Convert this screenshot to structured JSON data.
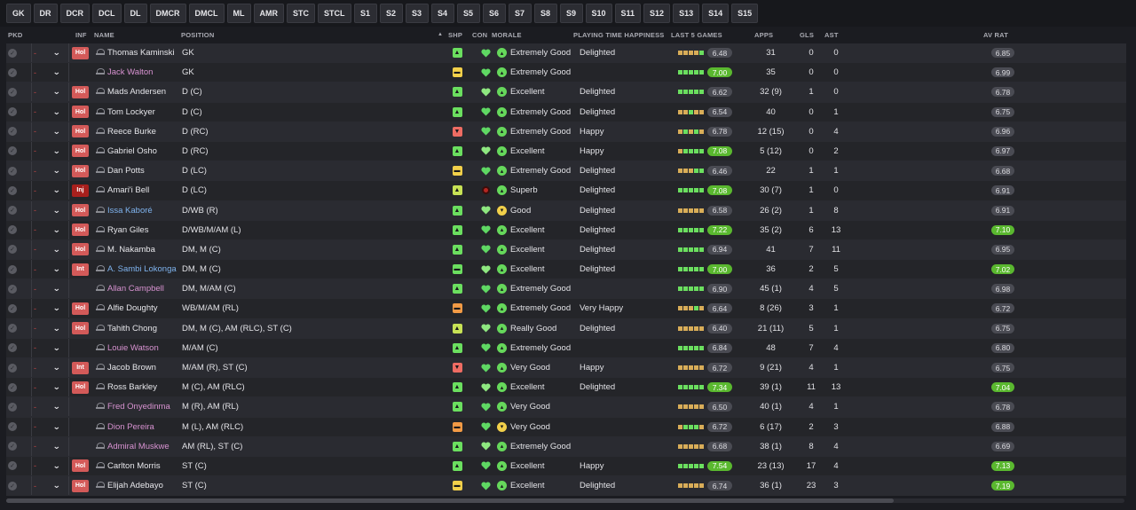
{
  "filters": [
    "GK",
    "DR",
    "DCR",
    "DCL",
    "DL",
    "DMCR",
    "DMCL",
    "ML",
    "AMR",
    "STC",
    "STCL",
    "S1",
    "S2",
    "S3",
    "S4",
    "S5",
    "S6",
    "S7",
    "S8",
    "S9",
    "S10",
    "S11",
    "S12",
    "S13",
    "S14",
    "S15"
  ],
  "headers": {
    "pkd": "PKD",
    "inf": "INF",
    "name": "NAME",
    "position": "POSITION",
    "sort": "▲",
    "shp": "SHP",
    "con": "CON",
    "morale": "MORALE",
    "pth": "PLAYING TIME HAPPINESS",
    "last5": "LAST 5 GAMES",
    "apps": "APPS",
    "gls": "GLS",
    "ast": "AST",
    "avrat": "AV RAT"
  },
  "dash": "-",
  "chevron": "⌄",
  "icons": {
    "selected": "check-circle-icon",
    "chevron": "chevron-down-icon",
    "person": "person-icon"
  },
  "colors": {
    "shp_up": "#6bdf5f",
    "shp_flat": "#f2d04a",
    "shp_down": "#ee6c63",
    "hot": "#5ab82f",
    "holiday": "#d35a59",
    "injury": "#a8201d"
  },
  "players": [
    {
      "inf": "Hol",
      "name": "Thomas Kaminski",
      "style": "",
      "pos": "GK",
      "shp": "up",
      "morale": "Extremely Good",
      "mc": "g",
      "pth": "Delighted",
      "bars": "oooog",
      "r5": "6.48",
      "r5hi": false,
      "apps": "31",
      "gls": "0",
      "ast": "0",
      "av": "6.85",
      "avhi": false
    },
    {
      "inf": "",
      "name": "Jack Walton",
      "style": "loan",
      "pos": "GK",
      "shp": "flat",
      "morale": "Extremely Good",
      "mc": "g",
      "pth": "",
      "bars": "ggggg",
      "r5": "7.00",
      "r5hi": true,
      "apps": "35",
      "gls": "0",
      "ast": "0",
      "av": "6.99",
      "avhi": false
    },
    {
      "inf": "Hol",
      "name": "Mads Andersen",
      "style": "",
      "pos": "D (C)",
      "shp": "up",
      "morale": "Excellent",
      "mc": "g",
      "pth": "Delighted",
      "bars": "ggggg",
      "r5": "6.62",
      "r5hi": false,
      "apps": "32 (9)",
      "gls": "1",
      "ast": "0",
      "av": "6.78",
      "avhi": false
    },
    {
      "inf": "Hol",
      "name": "Tom Lockyer",
      "style": "",
      "pos": "D (C)",
      "shp": "up",
      "morale": "Extremely Good",
      "mc": "g",
      "pth": "Delighted",
      "bars": "oogoo",
      "r5": "6.54",
      "r5hi": false,
      "apps": "40",
      "gls": "0",
      "ast": "1",
      "av": "6.75",
      "avhi": false
    },
    {
      "inf": "Hol",
      "name": "Reece Burke",
      "style": "",
      "pos": "D (RC)",
      "shp": "down",
      "morale": "Extremely Good",
      "mc": "g",
      "pth": "Happy",
      "bars": "ogogo",
      "r5": "6.78",
      "r5hi": false,
      "apps": "12 (15)",
      "gls": "0",
      "ast": "4",
      "av": "6.96",
      "avhi": false
    },
    {
      "inf": "Hol",
      "name": "Gabriel Osho",
      "style": "",
      "pos": "D (RC)",
      "shp": "up",
      "morale": "Excellent",
      "mc": "g",
      "pth": "Happy",
      "bars": "ogggg",
      "r5": "7.08",
      "r5hi": true,
      "apps": "5 (12)",
      "gls": "0",
      "ast": "2",
      "av": "6.97",
      "avhi": false
    },
    {
      "inf": "Hol",
      "name": "Dan Potts",
      "style": "",
      "pos": "D (LC)",
      "shp": "flat",
      "morale": "Extremely Good",
      "mc": "g",
      "pth": "Delighted",
      "bars": "ooogg",
      "r5": "6.46",
      "r5hi": false,
      "apps": "22",
      "gls": "1",
      "ast": "1",
      "av": "6.68",
      "avhi": false
    },
    {
      "inf": "Inj",
      "name": "Amari'i Bell",
      "style": "",
      "pos": "D (LC)",
      "shp": "yg",
      "morale": "Superb",
      "mc": "g",
      "pth": "Delighted",
      "bars": "ggggg",
      "r5": "7.08",
      "r5hi": true,
      "apps": "30 (7)",
      "gls": "1",
      "ast": "0",
      "av": "6.91",
      "avhi": false,
      "injured": true
    },
    {
      "inf": "Hol",
      "name": "Issa Kaboré",
      "style": "blue",
      "pos": "D/WB (R)",
      "shp": "up",
      "morale": "Good",
      "mc": "y",
      "pth": "Delighted",
      "bars": "ooooo",
      "r5": "6.58",
      "r5hi": false,
      "apps": "26 (2)",
      "gls": "1",
      "ast": "8",
      "av": "6.91",
      "avhi": false
    },
    {
      "inf": "Hol",
      "name": "Ryan Giles",
      "style": "",
      "pos": "D/WB/M/AM (L)",
      "shp": "up",
      "morale": "Excellent",
      "mc": "g",
      "pth": "Delighted",
      "bars": "ggggg",
      "r5": "7.22",
      "r5hi": true,
      "apps": "35 (2)",
      "gls": "6",
      "ast": "13",
      "av": "7.10",
      "avhi": true
    },
    {
      "inf": "Hol",
      "name": "M. Nakamba",
      "style": "",
      "pos": "DM, M (C)",
      "shp": "up",
      "morale": "Excellent",
      "mc": "g",
      "pth": "Delighted",
      "bars": "ggggg",
      "r5": "6.94",
      "r5hi": false,
      "apps": "41",
      "gls": "7",
      "ast": "11",
      "av": "6.95",
      "avhi": false
    },
    {
      "inf": "Int",
      "name": "A. Sambi Lokonga",
      "style": "blue",
      "pos": "DM, M (C)",
      "shp": "eq",
      "morale": "Excellent",
      "mc": "g",
      "pth": "Delighted",
      "bars": "ggggg",
      "r5": "7.00",
      "r5hi": true,
      "apps": "36",
      "gls": "2",
      "ast": "5",
      "av": "7.02",
      "avhi": true
    },
    {
      "inf": "",
      "name": "Allan Campbell",
      "style": "loan",
      "pos": "DM, M/AM (C)",
      "shp": "up",
      "morale": "Extremely Good",
      "mc": "g",
      "pth": "",
      "bars": "ggggg",
      "r5": "6.90",
      "r5hi": false,
      "apps": "45 (1)",
      "gls": "4",
      "ast": "5",
      "av": "6.98",
      "avhi": false
    },
    {
      "inf": "Hol",
      "name": "Alfie Doughty",
      "style": "",
      "pos": "WB/M/AM (RL)",
      "shp": "warn",
      "morale": "Extremely Good",
      "mc": "g",
      "pth": "Very Happy",
      "bars": "ooogo",
      "r5": "6.64",
      "r5hi": false,
      "apps": "8 (26)",
      "gls": "3",
      "ast": "1",
      "av": "6.72",
      "avhi": false
    },
    {
      "inf": "Hol",
      "name": "Tahith Chong",
      "style": "",
      "pos": "DM, M (C), AM (RLC), ST (C)",
      "shp": "yg",
      "morale": "Really Good",
      "mc": "g",
      "pth": "Delighted",
      "bars": "ooooo",
      "r5": "6.40",
      "r5hi": false,
      "apps": "21 (11)",
      "gls": "5",
      "ast": "1",
      "av": "6.75",
      "avhi": false
    },
    {
      "inf": "",
      "name": "Louie Watson",
      "style": "loan",
      "pos": "M/AM (C)",
      "shp": "up",
      "morale": "Extremely Good",
      "mc": "g",
      "pth": "",
      "bars": "ggggg",
      "r5": "6.84",
      "r5hi": false,
      "apps": "48",
      "gls": "7",
      "ast": "4",
      "av": "6.80",
      "avhi": false
    },
    {
      "inf": "Int",
      "name": "Jacob Brown",
      "style": "",
      "pos": "M/AM (R), ST (C)",
      "shp": "down",
      "morale": "Very Good",
      "mc": "g",
      "pth": "Happy",
      "bars": "ooooo",
      "r5": "6.72",
      "r5hi": false,
      "apps": "9 (21)",
      "gls": "4",
      "ast": "1",
      "av": "6.75",
      "avhi": false
    },
    {
      "inf": "Hol",
      "name": "Ross Barkley",
      "style": "",
      "pos": "M (C), AM (RLC)",
      "shp": "up",
      "morale": "Excellent",
      "mc": "g",
      "pth": "Delighted",
      "bars": "ggggg",
      "r5": "7.34",
      "r5hi": true,
      "apps": "39 (1)",
      "gls": "11",
      "ast": "13",
      "av": "7.04",
      "avhi": true
    },
    {
      "inf": "",
      "name": "Fred Onyedinma",
      "style": "loan",
      "pos": "M (R), AM (RL)",
      "shp": "up",
      "morale": "Very Good",
      "mc": "g",
      "pth": "",
      "bars": "ooooo",
      "r5": "6.50",
      "r5hi": false,
      "apps": "40 (1)",
      "gls": "4",
      "ast": "1",
      "av": "6.78",
      "avhi": false
    },
    {
      "inf": "",
      "name": "Dion Pereira",
      "style": "loan",
      "pos": "M (L), AM (RLC)",
      "shp": "warn",
      "morale": "Very Good",
      "mc": "y",
      "pth": "",
      "bars": "ogggo",
      "r5": "6.72",
      "r5hi": false,
      "apps": "6 (17)",
      "gls": "2",
      "ast": "3",
      "av": "6.88",
      "avhi": false
    },
    {
      "inf": "",
      "name": "Admiral Muskwe",
      "style": "loan",
      "pos": "AM (RL), ST (C)",
      "shp": "up",
      "morale": "Extremely Good",
      "mc": "g",
      "pth": "",
      "bars": "ooooo",
      "r5": "6.68",
      "r5hi": false,
      "apps": "38 (1)",
      "gls": "8",
      "ast": "4",
      "av": "6.69",
      "avhi": false
    },
    {
      "inf": "Hol",
      "name": "Carlton Morris",
      "style": "",
      "pos": "ST (C)",
      "shp": "up",
      "morale": "Excellent",
      "mc": "g",
      "pth": "Happy",
      "bars": "ggggg",
      "r5": "7.54",
      "r5hi": true,
      "apps": "23 (13)",
      "gls": "17",
      "ast": "4",
      "av": "7.13",
      "avhi": true
    },
    {
      "inf": "Hol",
      "name": "Elijah Adebayo",
      "style": "",
      "pos": "ST (C)",
      "shp": "flat",
      "morale": "Excellent",
      "mc": "g",
      "pth": "Delighted",
      "bars": "ooooo",
      "r5": "6.74",
      "r5hi": false,
      "apps": "36 (1)",
      "gls": "23",
      "ast": "3",
      "av": "7.19",
      "avhi": true
    }
  ]
}
